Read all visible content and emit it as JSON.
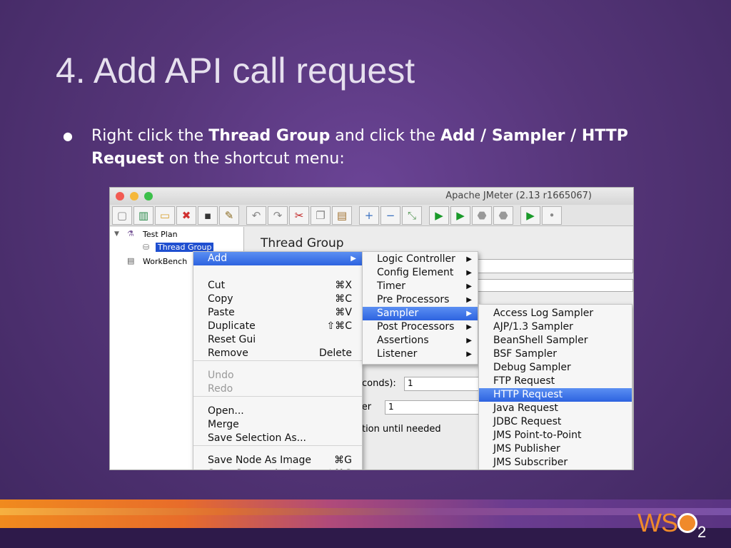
{
  "slide": {
    "title": "4. Add API call request",
    "bullet": {
      "pre": "Right click the ",
      "b1": "Thread Group",
      "mid": " and click the ",
      "b2": "Add / Sampler / HTTP Request",
      "post": " on the shortcut menu:"
    },
    "logo": "WSO2"
  },
  "app": {
    "window_title": "Apache JMeter (2.13 r1665067)",
    "toolbar": [
      "new",
      "templates",
      "open",
      "close",
      "save",
      "save-as",
      "undo",
      "redo",
      "cut",
      "copy",
      "paste",
      "expand",
      "collapse",
      "toggle",
      "start",
      "start-no-pause",
      "stop",
      "shutdown",
      "remote-start",
      "remote-clear"
    ],
    "tree": {
      "test_plan": "Test Plan",
      "thread_group": "Thread Group",
      "workbench": "WorkBench"
    },
    "panel": {
      "title": "Thread Group",
      "ramp_label": "econds):",
      "ramp_value": "1",
      "loop_label": "ver",
      "loop_value": "1",
      "delay_label": "ation until needed"
    },
    "context_menu": {
      "add": "Add",
      "items": [
        {
          "label": "Cut",
          "shortcut": "⌘X"
        },
        {
          "label": "Copy",
          "shortcut": "⌘C"
        },
        {
          "label": "Paste",
          "shortcut": "⌘V"
        },
        {
          "label": "Duplicate",
          "shortcut": "⇧⌘C"
        },
        {
          "label": "Reset Gui",
          "shortcut": ""
        },
        {
          "label": "Remove",
          "shortcut": "Delete"
        },
        {
          "label": "Undo",
          "shortcut": ""
        },
        {
          "label": "Redo",
          "shortcut": ""
        },
        {
          "label": "Open...",
          "shortcut": ""
        },
        {
          "label": "Merge",
          "shortcut": ""
        },
        {
          "label": "Save Selection As...",
          "shortcut": ""
        },
        {
          "label": "Save Node As Image",
          "shortcut": "⌘G"
        },
        {
          "label": "Save Screen As Image",
          "shortcut": "⇧⌘G"
        }
      ]
    },
    "add_menu": [
      "Logic Controller",
      "Config Element",
      "Timer",
      "Pre Processors",
      "Sampler",
      "Post Processors",
      "Assertions",
      "Listener"
    ],
    "sampler_menu": [
      "Access Log Sampler",
      "AJP/1.3 Sampler",
      "BeanShell Sampler",
      "BSF Sampler",
      "Debug Sampler",
      "FTP Request",
      "HTTP Request",
      "Java Request",
      "JDBC Request",
      "JMS Point-to-Point",
      "JMS Publisher",
      "JMS Subscriber"
    ]
  }
}
